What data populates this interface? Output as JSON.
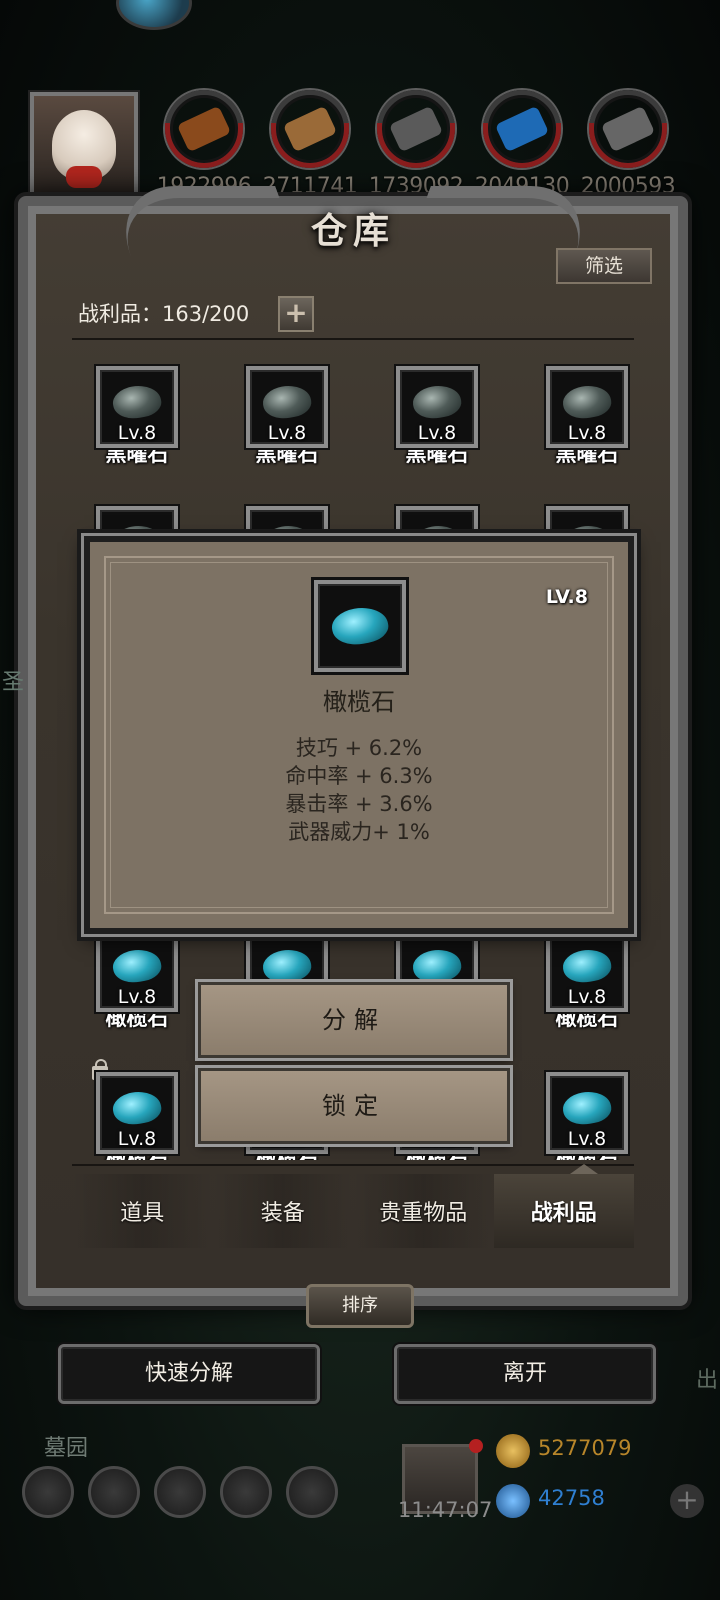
{
  "resources": [
    {
      "name": "wood-log",
      "value": "1922996",
      "color": "#8a4a1c"
    },
    {
      "name": "plank",
      "value": "2711741",
      "color": "#9a6a38"
    },
    {
      "name": "iron",
      "value": "1739092",
      "color": "#5a5a5a"
    },
    {
      "name": "crystal",
      "value": "2049130",
      "color": "#1e6ab5"
    },
    {
      "name": "steel",
      "value": "2000593",
      "color": "#666666"
    }
  ],
  "panel": {
    "title": "仓库",
    "filter_label": "筛选",
    "spoils_count": "战利品：163/200",
    "plus": "+"
  },
  "grid": {
    "row1": [
      {
        "name": "黑曜石",
        "level": "Lv.8"
      },
      {
        "name": "黑曜石",
        "level": "Lv.8"
      },
      {
        "name": "黑曜石",
        "level": "Lv.8"
      },
      {
        "name": "黑曜石",
        "level": "Lv.8"
      }
    ],
    "row3": [
      {
        "name": "橄榄石",
        "level": "Lv.8"
      },
      {
        "name": "橄榄石",
        "level": "Lv.8"
      }
    ],
    "row4": [
      {
        "name": "橄榄石",
        "level": "Lv.8"
      },
      {
        "name": "橄榄石",
        "level": "Lv.8"
      },
      {
        "name": "橄榄石",
        "level": "Lv.8"
      },
      {
        "name": "橄榄石",
        "level": "Lv.8"
      }
    ]
  },
  "popup": {
    "level": "LV.8",
    "item_name": "橄榄石",
    "stats": [
      "技巧 + 6.2%",
      "命中率 + 6.3%",
      "暴击率 + 3.6%",
      "武器威力+ 1%"
    ]
  },
  "actions": {
    "decompose": "分解",
    "lock": "锁定"
  },
  "tabs": [
    "道具",
    "装备",
    "贵重物品",
    "战利品"
  ],
  "active_tab": "战利品",
  "sort_label": "排序",
  "bottom": {
    "quick_decompose": "快速分解",
    "leave": "离开"
  },
  "hud": {
    "side_left": "圣",
    "side_right": "出",
    "area": "墓园",
    "clock": "11:47:07",
    "gold": "5277079",
    "gems": "42758",
    "gold_color": "#b8862a",
    "gem_color": "#2f7fd1"
  }
}
